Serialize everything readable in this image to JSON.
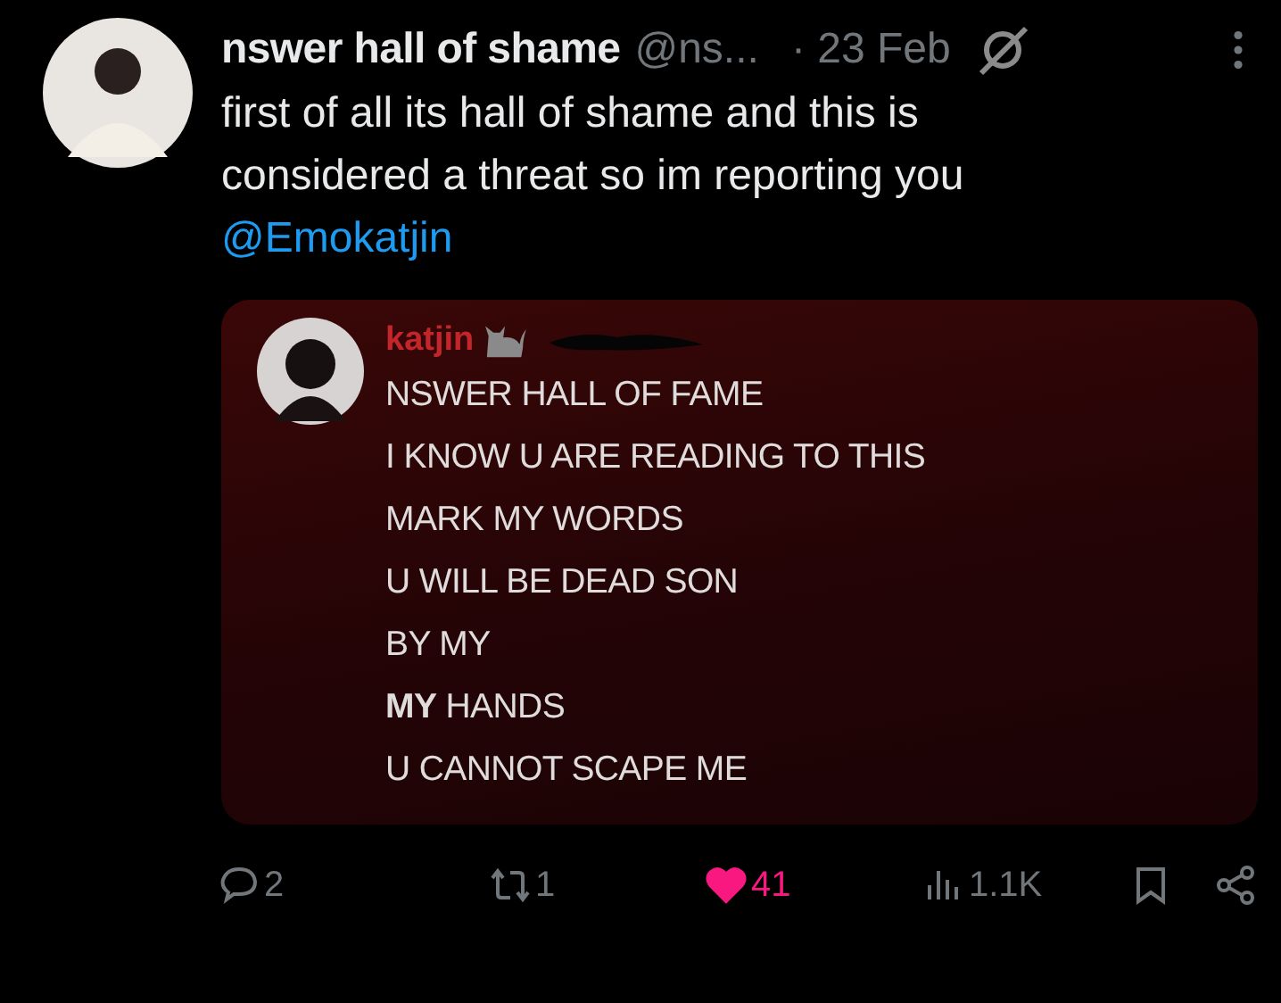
{
  "post": {
    "display_name": "nswer hall of shame",
    "handle": "@ns...",
    "time": "· 23 Feb",
    "text": "first of all its hall of shame and this is considered a threat so im reporting you",
    "mention": "@Emokatjin"
  },
  "embedded": {
    "username": "katjin",
    "lines": [
      "NSWER HALL OF FAME",
      "I KNOW U ARE READING TO THIS",
      "MARK MY WORDS",
      "U WILL BE DEAD SON",
      "BY MY",
      "**MY** HANDS",
      "U CANNOT SCAPE ME"
    ]
  },
  "actions": {
    "replies": "2",
    "reposts": "1",
    "likes": "41",
    "liked": true,
    "views": "1.1K"
  }
}
